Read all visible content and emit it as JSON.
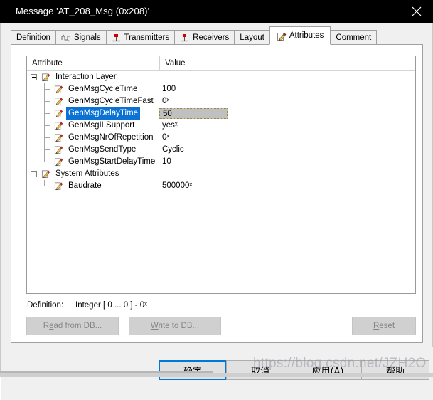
{
  "window": {
    "title": "Message 'AT_208_Msg (0x208)'",
    "close_icon": "close-icon"
  },
  "tabs": [
    {
      "label": "Definition",
      "icon": "",
      "selected": false
    },
    {
      "label": "Signals",
      "icon": "signal-wave-icon",
      "selected": false
    },
    {
      "label": "Transmitters",
      "icon": "node-icon",
      "selected": false
    },
    {
      "label": "Receivers",
      "icon": "node-icon",
      "selected": false
    },
    {
      "label": "Layout",
      "icon": "",
      "selected": false
    },
    {
      "label": "Attributes",
      "icon": "attribute-pencil-icon",
      "selected": true
    },
    {
      "label": "Comment",
      "icon": "",
      "selected": false
    }
  ],
  "table": {
    "columns": [
      "Attribute",
      "Value"
    ],
    "rows": [
      {
        "level": 0,
        "name": "Interaction Layer",
        "value": "",
        "expanded": true,
        "selected": false,
        "editing": false
      },
      {
        "level": 1,
        "name": "GenMsgCycleTime",
        "value": "100",
        "selected": false,
        "editing": false
      },
      {
        "level": 1,
        "name": "GenMsgCycleTimeFast",
        "value": "0ˣ",
        "selected": false,
        "editing": false
      },
      {
        "level": 1,
        "name": "GenMsgDelayTime",
        "value": "50",
        "selected": true,
        "editing": true
      },
      {
        "level": 1,
        "name": "GenMsgILSupport",
        "value": "yesˣ",
        "selected": false,
        "editing": false
      },
      {
        "level": 1,
        "name": "GenMsgNrOfRepetition",
        "value": "0ˣ",
        "selected": false,
        "editing": false
      },
      {
        "level": 1,
        "name": "GenMsgSendType",
        "value": "Cyclic",
        "selected": false,
        "editing": false
      },
      {
        "level": 1,
        "name": "GenMsgStartDelayTime",
        "value": "10",
        "selected": false,
        "editing": false
      },
      {
        "level": 0,
        "name": "System Attributes",
        "value": "",
        "expanded": true,
        "selected": false,
        "editing": false
      },
      {
        "level": 1,
        "name": "Baudrate",
        "value": "500000ˣ",
        "selected": false,
        "editing": false
      }
    ]
  },
  "definition": {
    "label": "Definition:",
    "value": "Integer [ 0 ... 0 ] - 0ˣ"
  },
  "db_buttons": {
    "read_prefix": "R",
    "read_accel": "e",
    "read_suffix": "ad from DB...",
    "write_accel": "W",
    "write_suffix": "rite to DB...",
    "reset_accel": "R",
    "reset_suffix": "eset"
  },
  "footer_buttons": [
    {
      "label": "确定",
      "default": true
    },
    {
      "label": "取消",
      "default": false
    },
    {
      "label": "应用(A)",
      "default": false
    },
    {
      "label": "帮助",
      "default": false
    }
  ],
  "watermark": "https://blog.csdn.net/JZH2O",
  "colors": {
    "selection": "#0a72d4",
    "title_bar": "#000000",
    "accent_focus": "#0078d7",
    "edit_cell": "#c0c0c0"
  }
}
